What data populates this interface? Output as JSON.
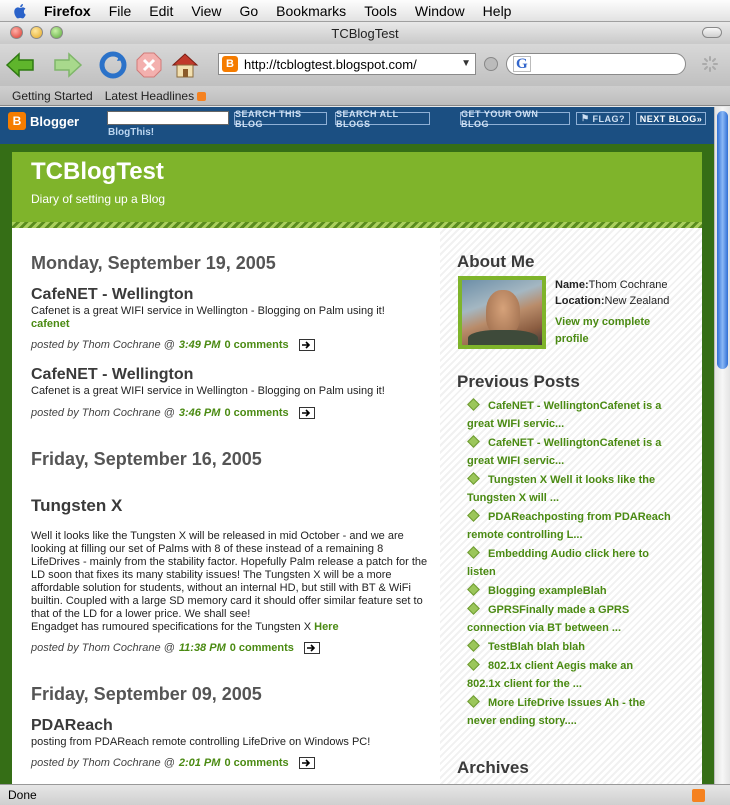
{
  "menubar": {
    "items": [
      "Firefox",
      "File",
      "Edit",
      "View",
      "Go",
      "Bookmarks",
      "Tools",
      "Window",
      "Help"
    ]
  },
  "window": {
    "title": "TCBlogTest"
  },
  "toolbar": {
    "url": "http://tcblogtest.blogspot.com/",
    "search_engine": "G"
  },
  "bookmarks": [
    "Getting Started",
    "Latest Headlines"
  ],
  "navbar": {
    "logo": "Blogger",
    "search_this": "SEARCH THIS BLOG",
    "search_all": "SEARCH ALL BLOGS",
    "get_own": "GET YOUR OWN BLOG",
    "flag": "FLAG?",
    "next": "NEXT BLOG»",
    "blogthis": "BlogThis!"
  },
  "blog": {
    "title": "TCBlogTest",
    "description": "Diary of setting up a Blog"
  },
  "posts": [
    {
      "date": "Monday, September 19, 2005",
      "title": "CafeNET - Wellington",
      "body": "Cafenet is a great WIFI service in Wellington - Blogging on Palm using it!",
      "link": "cafenet",
      "author": "posted by Thom Cochrane @",
      "time": "3:49 PM",
      "comments": "0 comments"
    },
    {
      "title": "CafeNET - Wellington",
      "body": "Cafenet is a great WIFI service in Wellington - Blogging on Palm using it!",
      "author": "posted by Thom Cochrane @",
      "time": "3:46 PM",
      "comments": "0 comments"
    },
    {
      "date": "Friday, September 16, 2005",
      "title": "Tungsten X",
      "body": "Well it looks like the Tungsten X will be released in mid October - and we are looking at filling our set of Palms with 8 of these instead of a remaining 8 LifeDrives - mainly from the stability factor. Hopefully Palm release a patch for the LD soon that fixes its many stability issues! The Tungsten X will be a more affordable solution for students, without an internal HD, but still with BT & WiFi builtin. Coupled with a large SD memory card it should offer similar feature set to that of the LD for a lower price. We shall see!",
      "body2": "Engadget has rumoured specifications for the Tungsten X",
      "link": "Here",
      "author": "posted by Thom Cochrane @",
      "time": "11:38 PM",
      "comments": "0 comments"
    },
    {
      "date": "Friday, September 09, 2005",
      "title": "PDAReach",
      "body": "posting from PDAReach remote controlling LifeDrive on Windows PC!",
      "author": "posted by Thom Cochrane @",
      "time": "2:01 PM",
      "comments": "0 comments"
    }
  ],
  "sidebar": {
    "about_title": "About Me",
    "name_label": "Name:",
    "name": "Thom Cochrane",
    "location_label": "Location:",
    "location": "New Zealand",
    "profile_link1": "View my complete",
    "profile_link2": "profile",
    "prev_title": "Previous Posts",
    "prev_posts": [
      [
        "CafeNET - WellingtonCafenet is a",
        "great WIFI servic..."
      ],
      [
        "CafeNET - WellingtonCafenet is a",
        "great WIFI servic..."
      ],
      [
        "Tungsten X Well it looks like the",
        "Tungsten X will ..."
      ],
      [
        "PDAReachposting from PDAReach",
        "remote controlling L..."
      ],
      [
        "Embedding Audio click here to",
        "listen"
      ],
      [
        "Blogging exampleBlah"
      ],
      [
        "GPRSFinally made a GPRS",
        "connection via BT between ..."
      ],
      [
        "TestBlah blah blah"
      ],
      [
        "802.1x client Aegis make an",
        "802.1x client for the ..."
      ],
      [
        "More LifeDrive Issues Ah - the",
        "never ending story...."
      ]
    ],
    "archives_title": "Archives"
  },
  "status": {
    "text": "Done"
  },
  "colors": {
    "blogger_nav": "#1b4f82",
    "header_green": "#7fb42b",
    "frame_green": "#356e16",
    "link_green": "#4a8a12"
  }
}
